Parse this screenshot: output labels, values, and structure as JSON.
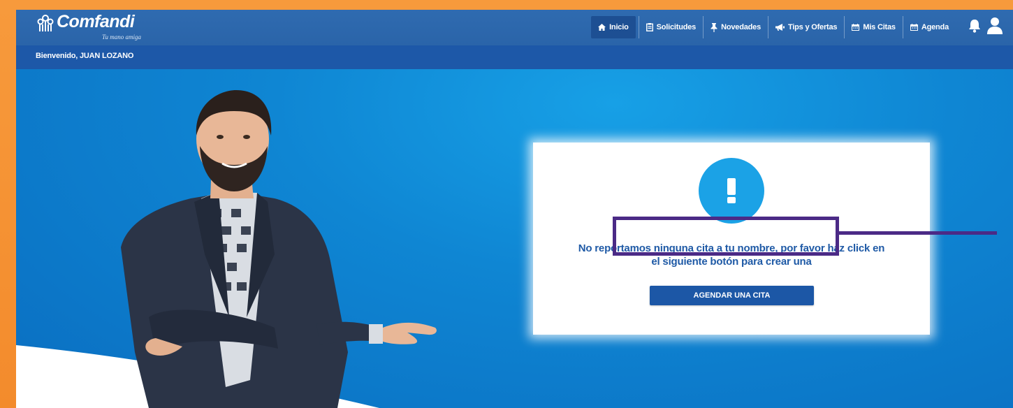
{
  "brand": {
    "name": "Comfandi",
    "tagline": "Tu mano amiga"
  },
  "nav": {
    "items": [
      {
        "label": "Inicio",
        "icon": "home-icon",
        "active": true
      },
      {
        "label": "Solicitudes",
        "icon": "clipboard-icon",
        "active": false
      },
      {
        "label": "Novedades",
        "icon": "pin-icon",
        "active": false
      },
      {
        "label": "Tips y Ofertas",
        "icon": "megaphone-icon",
        "active": false
      },
      {
        "label": "Mis Citas",
        "icon": "calendar-icon",
        "active": false
      },
      {
        "label": "Agenda",
        "icon": "calendar-icon",
        "active": false
      }
    ],
    "right_icons": [
      "bell-icon",
      "user-icon"
    ]
  },
  "subbar": {
    "welcome": "Bienvenido, JUAN LOZANO"
  },
  "card": {
    "icon": "exclamation-icon",
    "message_line1": "No reportamos ninguna cita a tu nombre, por favor haz click en",
    "message_line2": "el siguiente botón para crear una",
    "button_label": "AGENDAR UNA CITA"
  },
  "colors": {
    "frame_orange": "#f38b2c",
    "navbar_blue": "#2f6bb0",
    "subbar_blue": "#1d58a8",
    "hero_blue": "#0f86d3",
    "alert_circle": "#1ba2e6",
    "button_blue": "#1c57a6",
    "highlight_purple": "#4b2a86"
  }
}
